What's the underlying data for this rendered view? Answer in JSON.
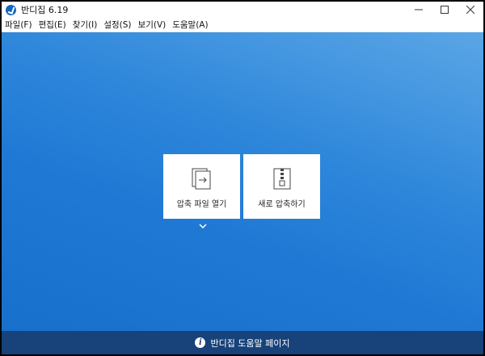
{
  "window": {
    "title": "반디집 6.19",
    "controls": {
      "minimize": "minimize-icon",
      "maximize": "maximize-icon",
      "close": "close-icon"
    }
  },
  "menu": {
    "items": [
      {
        "label": "파일(F)"
      },
      {
        "label": "편집(E)"
      },
      {
        "label": "찾기(I)"
      },
      {
        "label": "설정(S)"
      },
      {
        "label": "보기(V)"
      },
      {
        "label": "도움말(A)"
      }
    ]
  },
  "main": {
    "open_archive": {
      "label": "압축 파일 열기",
      "icon": "open-archive-icon"
    },
    "new_archive": {
      "label": "새로 압축하기",
      "icon": "zip-file-icon"
    },
    "expand_icon": "chevron-down-icon"
  },
  "footer": {
    "help_label": "반디집 도움말 페이지",
    "icon": "info-icon"
  },
  "colors": {
    "background_top": "#5aa6e6",
    "background_bottom": "#1770cc",
    "footer": "#17427a",
    "card": "#ffffff"
  }
}
